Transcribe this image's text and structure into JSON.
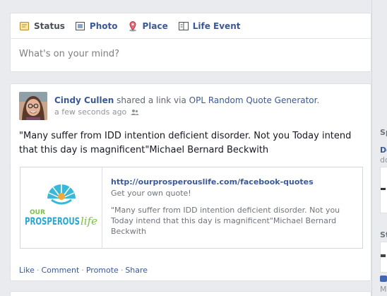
{
  "composer": {
    "tabs": [
      {
        "label": "Status",
        "icon": "status-icon"
      },
      {
        "label": "Photo",
        "icon": "photo-icon"
      },
      {
        "label": "Place",
        "icon": "place-pin-icon"
      },
      {
        "label": "Life Event",
        "icon": "life-event-icon"
      }
    ],
    "placeholder": "What's on your mind?"
  },
  "story": {
    "author": "Cindy Cullen",
    "action": "shared a link via",
    "app": "OPL Random Quote Generator",
    "app_suffix": ".",
    "timestamp": "a few seconds ago",
    "audience_icon": "friends-icon",
    "text": "\"Many suffer from IDD intention deficient disorder. Not you Today intend that this day is magnificent\"Michael Bernard Beckwith",
    "attachment": {
      "url": "http://ourprosperouslife.com/facebook-quotes",
      "caption": "Get your own quote!",
      "description": "\"Many suffer from IDD intention deficient disorder. Not you Today intend that this day is magnificent\"Michael Bernard Beckwith",
      "logo_top": "OUR",
      "logo_main": "PROSPEROUS",
      "logo_tail": "life"
    },
    "actions": [
      "Like",
      "Comment",
      "Promote",
      "Share"
    ],
    "action_separator": "·"
  },
  "right_column": {
    "cut_text": [
      "Sp",
      "De",
      "do",
      "St",
      "M"
    ]
  },
  "colors": {
    "link": "#3b5998",
    "muted": "#90949c",
    "background": "#e9ebee"
  }
}
